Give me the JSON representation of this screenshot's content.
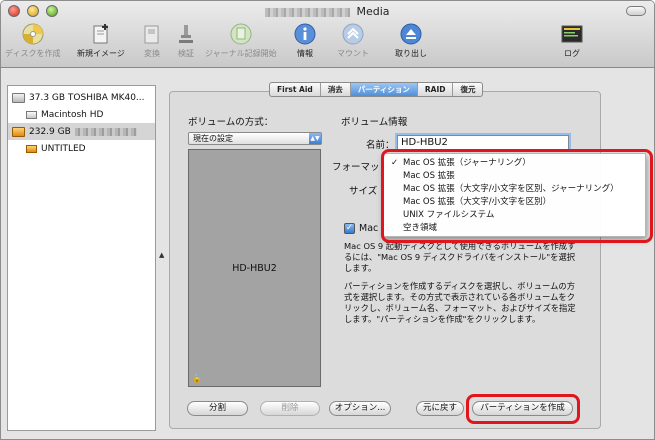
{
  "window": {
    "title": "Media"
  },
  "toolbar": {
    "items": [
      {
        "label": "ディスクを作成",
        "icon": "burn-disc-icon",
        "enabled": false
      },
      {
        "label": "新規イメージ",
        "icon": "new-image-icon",
        "enabled": true
      },
      {
        "label": "変換",
        "icon": "convert-icon",
        "enabled": false
      },
      {
        "label": "検証",
        "icon": "verify-microscope-icon",
        "enabled": false
      },
      {
        "label": "ジャーナル記録開始",
        "icon": "enable-journaling-icon",
        "enabled": false
      },
      {
        "label": "情報",
        "icon": "info-icon",
        "enabled": true
      },
      {
        "label": "マウント",
        "icon": "mount-icon",
        "enabled": false
      },
      {
        "label": "取り出し",
        "icon": "eject-icon",
        "enabled": true
      },
      {
        "label": "ログ",
        "icon": "log-console-icon",
        "enabled": true
      }
    ]
  },
  "sidebar": {
    "items": [
      {
        "label": "37.3 GB TOSHIBA MK40...",
        "kind": "disk"
      },
      {
        "label": "Macintosh HD",
        "kind": "volume"
      },
      {
        "label": "232.9 GB",
        "kind": "disk-external",
        "selected": true
      },
      {
        "label": "UNTITLED",
        "kind": "volume-external"
      }
    ]
  },
  "tabs": [
    {
      "label": "First Aid"
    },
    {
      "label": "消去"
    },
    {
      "label": "パーティション",
      "active": true
    },
    {
      "label": "RAID"
    },
    {
      "label": "復元"
    }
  ],
  "partition": {
    "scheme_heading": "ボリュームの方式：",
    "scheme_value": "現在の設定",
    "volume_name": "HD-HBU2",
    "info_heading": "ボリューム情報",
    "name_label": "名前：",
    "name_value": "HD-HBU2",
    "format_label": "フォーマット",
    "size_label": "サイズ",
    "checkbox_label": "Mac OS 9",
    "checkbox_checked": true,
    "os9_description": "Mac OS 9 起動ディスクとして使用できるボリュームを作成するには、\"Mac OS 9 ディスクドライバをインストール\"を選択します。",
    "help_text": "パーティションを作成するディスクを選択し、ボリュームの方式を選択します。その方式で表示されている各ボリュームをクリックし、ボリューム名、フォーマット、およびサイズを指定します。\"パーティションを作成\"をクリックします。"
  },
  "format_menu": {
    "options": [
      {
        "label": "Mac OS 拡張（ジャーナリング）",
        "checked": true
      },
      {
        "label": "Mac OS 拡張",
        "checked": false
      },
      {
        "label": "Mac OS 拡張（大文字/小文字を区別、ジャーナリング）",
        "checked": false
      },
      {
        "label": "Mac OS 拡張（大文字/小文字を区別）",
        "checked": false
      },
      {
        "label": "UNIX ファイルシステム",
        "checked": false
      },
      {
        "label": "空き領域",
        "checked": false
      }
    ]
  },
  "buttons": {
    "split": "分割",
    "delete": "削除",
    "options": "オプション...",
    "revert": "元に戻す",
    "partition": "パーティションを作成"
  },
  "colors": {
    "highlight": "#e0161f",
    "selection": "#4f8fd8"
  }
}
